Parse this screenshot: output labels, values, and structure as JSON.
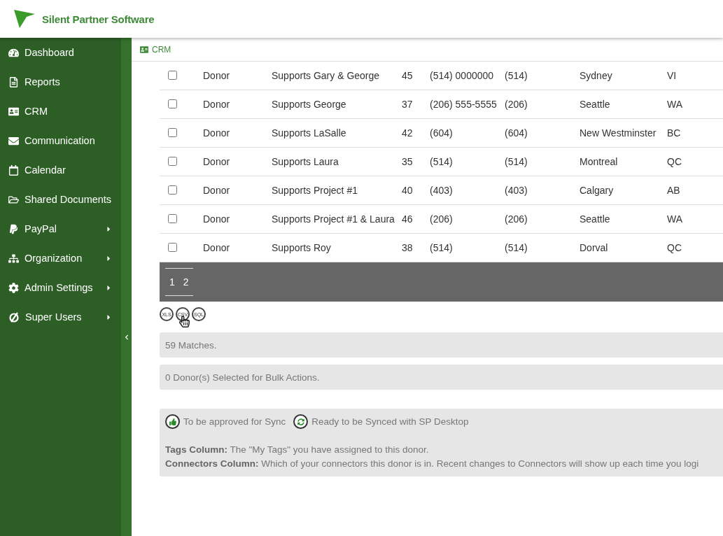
{
  "header": {
    "brand": "Silent Partner Software"
  },
  "sidebar": {
    "items": [
      {
        "label": "Dashboard",
        "has_submenu": false
      },
      {
        "label": "Reports",
        "has_submenu": false
      },
      {
        "label": "CRM",
        "has_submenu": false
      },
      {
        "label": "Communication",
        "has_submenu": false
      },
      {
        "label": "Calendar",
        "has_submenu": false
      },
      {
        "label": "Shared Documents",
        "has_submenu": false
      },
      {
        "label": "PayPal",
        "has_submenu": true
      },
      {
        "label": "Organization",
        "has_submenu": true
      },
      {
        "label": "Admin Settings",
        "has_submenu": true
      },
      {
        "label": "Super Users",
        "has_submenu": true
      }
    ]
  },
  "breadcrumb": "CRM",
  "table": {
    "rows": [
      {
        "checked": false,
        "type": "Donor",
        "name": "Supports Gary & George",
        "number": "45",
        "phone": "(514) 0000000",
        "phone_2": "(514)",
        "city": "Sydney",
        "state": "VI"
      },
      {
        "checked": false,
        "type": "Donor",
        "name": "Supports George",
        "number": "37",
        "phone": "(206) 555-5555",
        "phone_2": "(206)",
        "city": "Seattle",
        "state": "WA"
      },
      {
        "checked": false,
        "type": "Donor",
        "name": "Supports LaSalle",
        "number": "42",
        "phone": "(604)",
        "phone_2": "(604)",
        "city": "New Westminster",
        "state": "BC"
      },
      {
        "checked": false,
        "type": "Donor",
        "name": "Supports Laura",
        "number": "35",
        "phone": "(514)",
        "phone_2": "(514)",
        "city": "Montreal",
        "state": "QC"
      },
      {
        "checked": false,
        "type": "Donor",
        "name": "Supports Project #1",
        "number": "40",
        "phone": "(403)",
        "phone_2": "(403)",
        "city": "Calgary",
        "state": "AB"
      },
      {
        "checked": false,
        "type": "Donor",
        "name": "Supports Project #1 & Laura",
        "number": "46",
        "phone": "(206)",
        "phone_2": "(206)",
        "city": "Seattle",
        "state": "WA"
      },
      {
        "checked": false,
        "type": "Donor",
        "name": "Supports Roy",
        "number": "38",
        "phone": "(514)",
        "phone_2": "(514)",
        "city": "Dorval",
        "state": "QC"
      }
    ]
  },
  "pagination": {
    "pages": [
      "1",
      "2"
    ]
  },
  "exports": [
    "XLS",
    "CSV",
    "SQL"
  ],
  "matches": "59 Matches.",
  "selected_info": "0 Donor(s) Selected for Bulk Actions.",
  "legend": {
    "items": [
      "To be approved for Sync",
      "Ready to be Synced with SP Desktop"
    ],
    "notes": [
      "**Tags Column:** The \"My Tags\" you have assigned to this donor.",
      "**Connectors Column:** Which of your connectors this donor is in. Recent changes to Connectors will show up each time you logi"
    ]
  }
}
